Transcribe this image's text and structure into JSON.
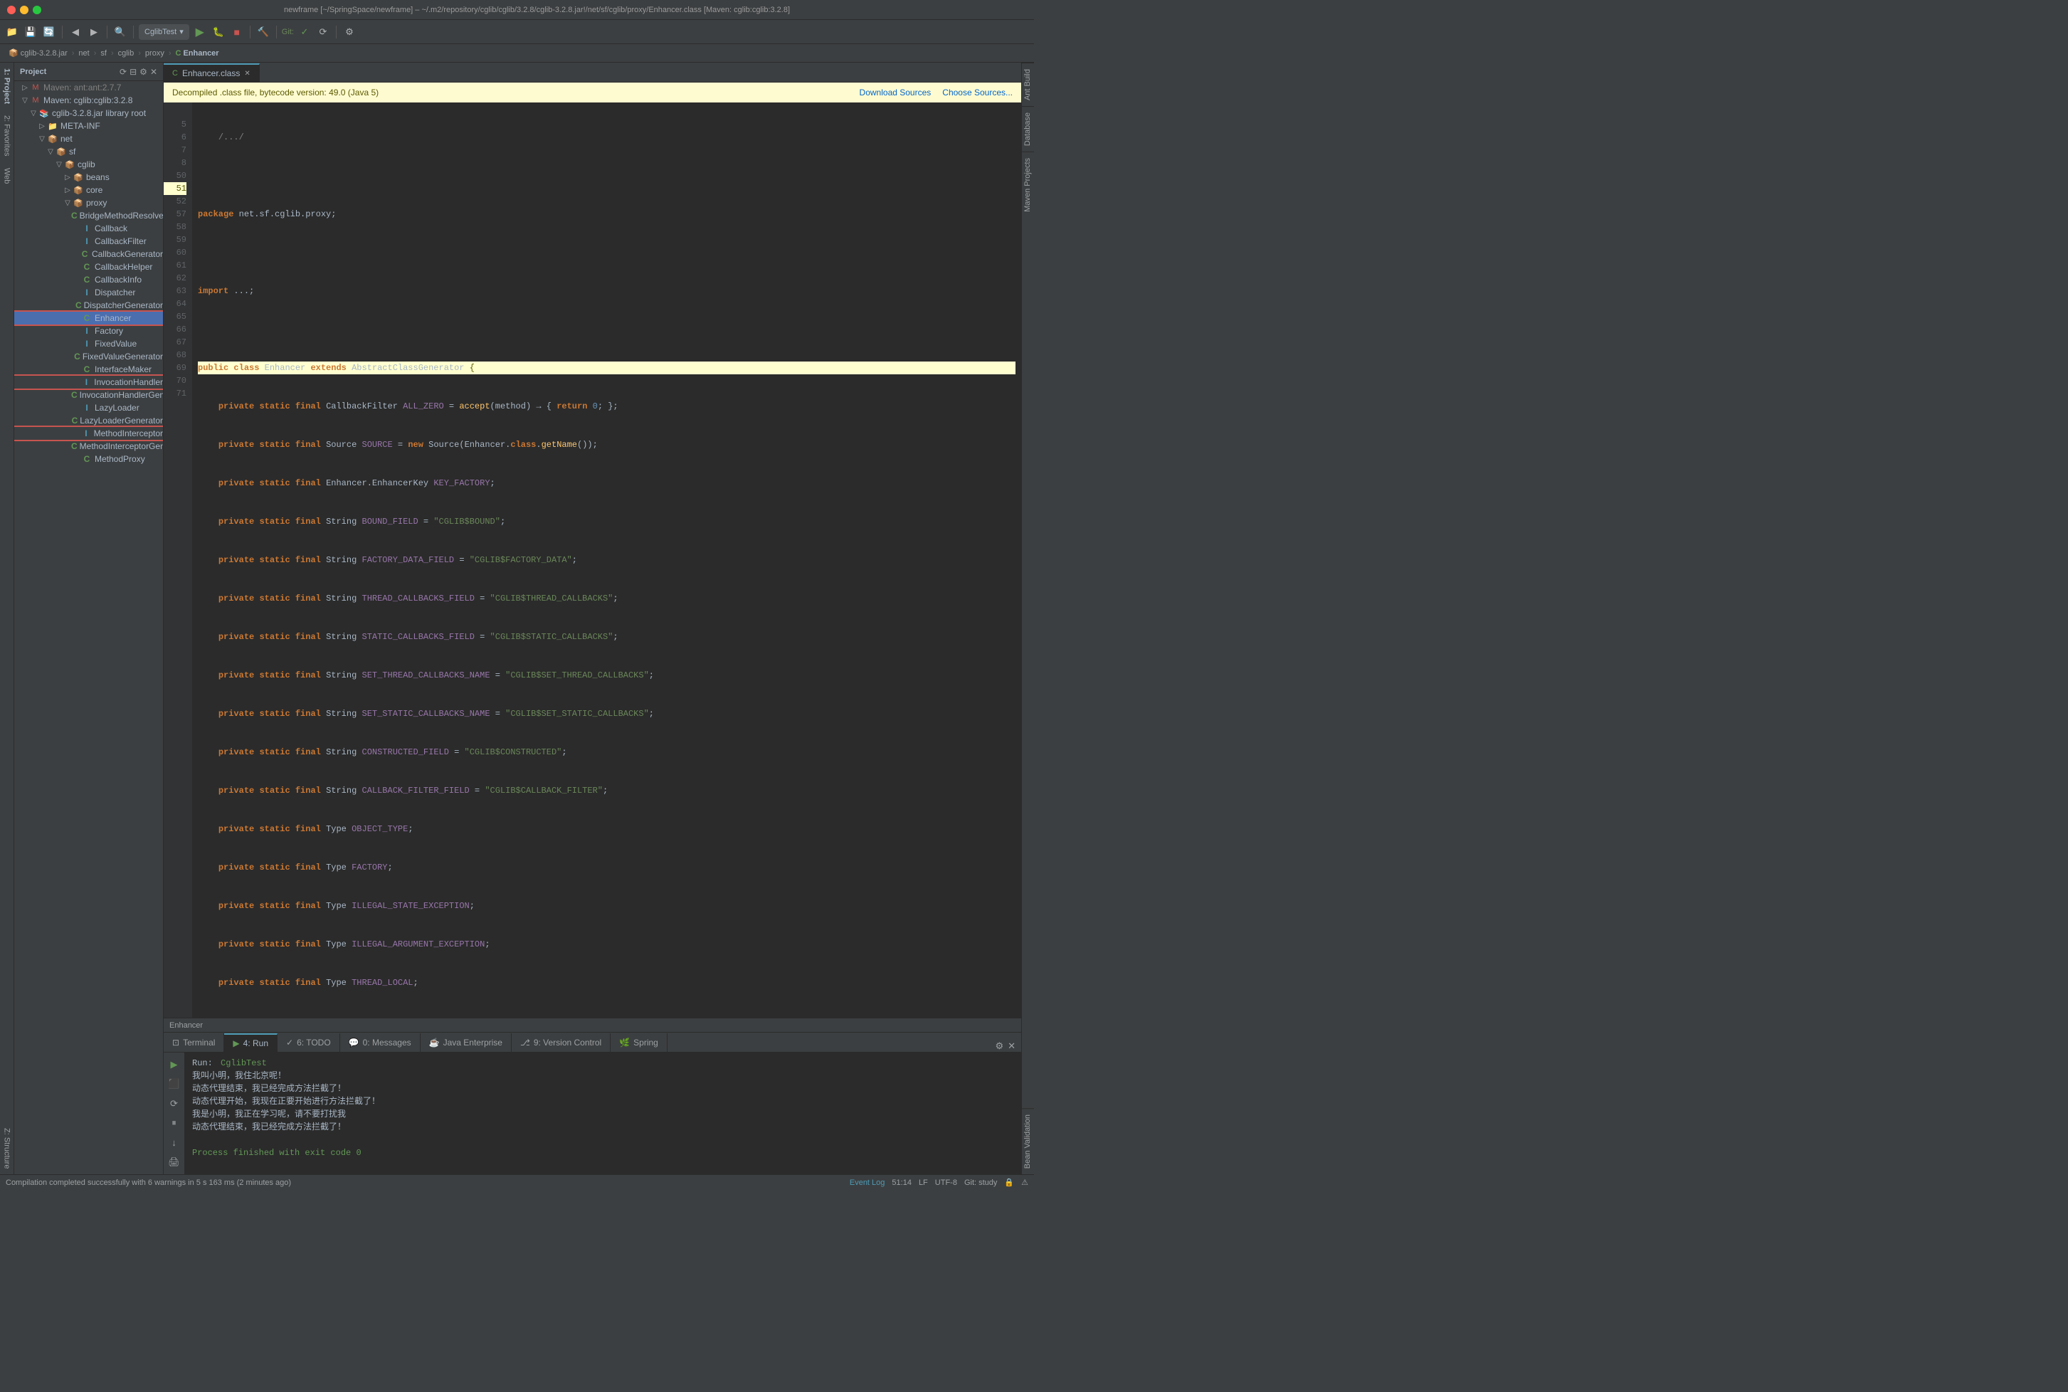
{
  "window": {
    "titlebar": "newframe [~/SpringSpace/newframe] – ~/.m2/repository/cglib/cglib/3.2.8/cglib-3.2.8.jar!/net/sf/cglib/proxy/Enhancer.class [Maven: cglib:cglib:3.2.8]"
  },
  "toolbar": {
    "run_config": "CglibTest",
    "git_label": "Git:"
  },
  "breadcrumb": {
    "items": [
      "cglib-3.2.8.jar",
      "net",
      "sf",
      "cglib",
      "proxy",
      "Enhancer"
    ]
  },
  "tabs": [
    {
      "label": "Enhancer.class",
      "active": true,
      "closable": true
    }
  ],
  "banner": {
    "text": "Decompiled .class file, bytecode version: 49.0 (Java 5)",
    "download_sources": "Download Sources",
    "choose_sources": "Choose Sources..."
  },
  "code": {
    "lines": [
      {
        "num": "",
        "content": ""
      },
      {
        "num": 5,
        "content": ""
      },
      {
        "num": 6,
        "content": "package net.sf.cglib.proxy;"
      },
      {
        "num": 7,
        "content": ""
      },
      {
        "num": 8,
        "content": "import ...;"
      },
      {
        "num": 50,
        "content": ""
      },
      {
        "num": 51,
        "content": "public class Enhancer extends AbstractClassGenerator {"
      },
      {
        "num": 52,
        "content": "    private static final CallbackFilter ALL_ZERO = accept(method) -> { return 0; };"
      },
      {
        "num": 57,
        "content": "    private static final Source SOURCE = new Source(Enhancer.class.getName());"
      },
      {
        "num": 58,
        "content": "    private static final Enhancer.EnhancerKey KEY_FACTORY;"
      },
      {
        "num": 59,
        "content": "    private static final String BOUND_FIELD = \"CGLIB$BOUND\";"
      },
      {
        "num": 60,
        "content": "    private static final String FACTORY_DATA_FIELD = \"CGLIB$FACTORY_DATA\";"
      },
      {
        "num": 61,
        "content": "    private static final String THREAD_CALLBACKS_FIELD = \"CGLIB$THREAD_CALLBACKS\";"
      },
      {
        "num": 62,
        "content": "    private static final String STATIC_CALLBACKS_FIELD = \"CGLIB$STATIC_CALLBACKS\";"
      },
      {
        "num": 63,
        "content": "    private static final String SET_THREAD_CALLBACKS_NAME = \"CGLIB$SET_THREAD_CALLBACKS\";"
      },
      {
        "num": 64,
        "content": "    private static final String SET_STATIC_CALLBACKS_NAME = \"CGLIB$SET_STATIC_CALLBACKS\";"
      },
      {
        "num": 65,
        "content": "    private static final String CONSTRUCTED_FIELD = \"CGLIB$CONSTRUCTED\";"
      },
      {
        "num": 66,
        "content": "    private static final String CALLBACK_FILTER_FIELD = \"CGLIB$CALLBACK_FILTER\";"
      },
      {
        "num": 67,
        "content": "    private static final Type OBJECT_TYPE;"
      },
      {
        "num": 68,
        "content": "    private static final Type FACTORY;"
      },
      {
        "num": 69,
        "content": "    private static final Type ILLEGAL_STATE_EXCEPTION;"
      },
      {
        "num": 70,
        "content": "    private static final Type ILLEGAL_ARGUMENT_EXCEPTION;"
      },
      {
        "num": 71,
        "content": "    private static final Type THREAD_LOCAL;"
      }
    ]
  },
  "sidebar": {
    "title": "Project",
    "tree": [
      {
        "label": "Maven: ant:ant:2.7.7",
        "level": 2,
        "type": "maven",
        "expanded": false
      },
      {
        "label": "Maven: cglib:cglib:3.2.8",
        "level": 2,
        "type": "maven",
        "expanded": true
      },
      {
        "label": "cglib-3.2.8.jar library root",
        "level": 3,
        "type": "jar",
        "expanded": true
      },
      {
        "label": "META-INF",
        "level": 4,
        "type": "folder",
        "expanded": false
      },
      {
        "label": "net",
        "level": 4,
        "type": "package",
        "expanded": true
      },
      {
        "label": "sf",
        "level": 5,
        "type": "package",
        "expanded": true
      },
      {
        "label": "cglib",
        "level": 6,
        "type": "package",
        "expanded": true
      },
      {
        "label": "beans",
        "level": 7,
        "type": "package",
        "expanded": false
      },
      {
        "label": "core",
        "level": 7,
        "type": "package",
        "expanded": false
      },
      {
        "label": "proxy",
        "level": 7,
        "type": "package",
        "expanded": true
      },
      {
        "label": "BridgeMethodResolver",
        "level": 8,
        "type": "class"
      },
      {
        "label": "Callback",
        "level": 8,
        "type": "interface",
        "highlighted": false
      },
      {
        "label": "CallbackFilter",
        "level": 8,
        "type": "interface"
      },
      {
        "label": "CallbackGenerator",
        "level": 8,
        "type": "class"
      },
      {
        "label": "CallbackHelper",
        "level": 8,
        "type": "class"
      },
      {
        "label": "CallbackInfo",
        "level": 8,
        "type": "class"
      },
      {
        "label": "Dispatcher",
        "level": 8,
        "type": "interface"
      },
      {
        "label": "DispatcherGenerator",
        "level": 8,
        "type": "class"
      },
      {
        "label": "Enhancer",
        "level": 8,
        "type": "class",
        "selected": true,
        "highlighted": true
      },
      {
        "label": "Factory",
        "level": 8,
        "type": "interface",
        "highlighted": false
      },
      {
        "label": "FixedValue",
        "level": 8,
        "type": "interface"
      },
      {
        "label": "FixedValueGenerator",
        "level": 8,
        "type": "class"
      },
      {
        "label": "InterfaceMaker",
        "level": 8,
        "type": "class"
      },
      {
        "label": "InvocationHandler",
        "level": 8,
        "type": "interface",
        "highlighted": true
      },
      {
        "label": "InvocationHandlerGenerator",
        "level": 8,
        "type": "class"
      },
      {
        "label": "LazyLoader",
        "level": 8,
        "type": "interface"
      },
      {
        "label": "LazyLoaderGenerator",
        "level": 8,
        "type": "class"
      },
      {
        "label": "MethodInterceptor",
        "level": 8,
        "type": "interface",
        "highlighted": true
      },
      {
        "label": "MethodInterceptorGenerator",
        "level": 8,
        "type": "class"
      },
      {
        "label": "MethodProxy",
        "level": 8,
        "type": "class"
      }
    ]
  },
  "bottom_panel": {
    "run_tab": "Run:",
    "run_config_name": "CglibTest",
    "output_lines": [
      "我叫小明，我住北京呢！",
      "动态代理结束，我已经完成方法拦截了！",
      "动态代理开始，我现在正要开始进行方法拦截了！",
      "我是小明，我正在学习呢，请不要打扰我",
      "动态代理结束，我已经完成方法拦截了！",
      "",
      "Process finished with exit code 0"
    ]
  },
  "bottom_tabs": [
    {
      "label": "Terminal",
      "icon": "terminal"
    },
    {
      "label": "4: Run",
      "icon": "run",
      "active": true
    },
    {
      "label": "6: TODO",
      "icon": "todo"
    },
    {
      "label": "0: Messages",
      "icon": "messages"
    },
    {
      "label": "Java Enterprise",
      "icon": "java"
    },
    {
      "label": "9: Version Control",
      "icon": "git"
    },
    {
      "label": "Spring",
      "icon": "spring"
    }
  ],
  "statusbar": {
    "text": "Compilation completed successfully with 6 warnings in 5 s 163 ms (2 minutes ago)",
    "position": "51:14",
    "encoding": "UTF-8",
    "line_separator": "LF",
    "git_branch": "Git: study",
    "event_log": "Event Log"
  },
  "right_panels": [
    "Ant Build",
    "Database",
    "Maven Projects",
    "Bean Validation"
  ],
  "left_panels": [
    "1: Project",
    "2: Favorites",
    "Web",
    "Z: Structure"
  ],
  "editor_breadcrumb": "Enhancer"
}
